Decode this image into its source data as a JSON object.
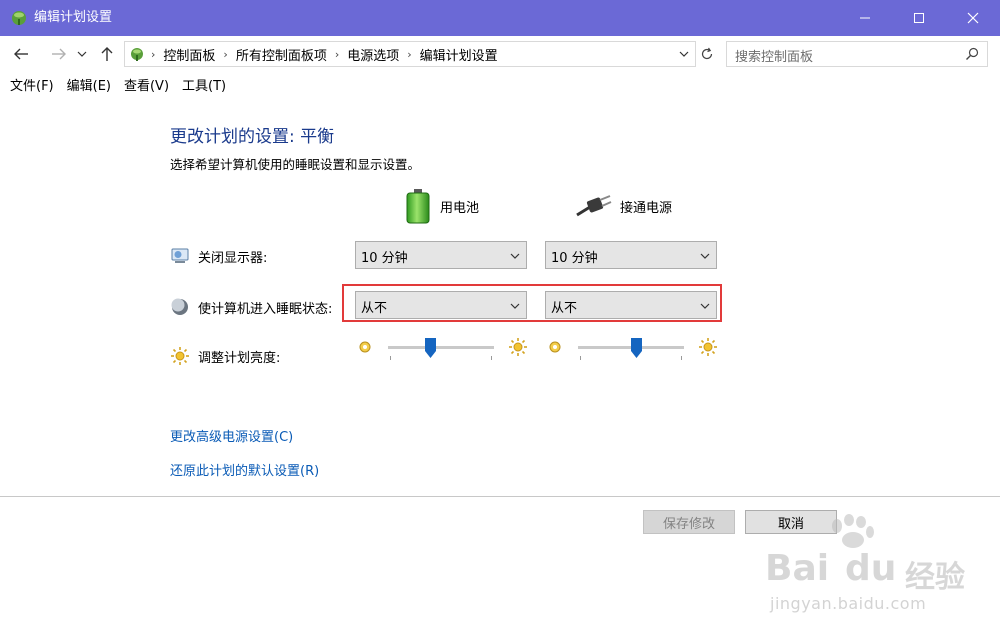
{
  "window": {
    "title": "编辑计划设置",
    "icon": "power-plan-icon"
  },
  "nav": {
    "breadcrumbs": [
      "控制面板",
      "所有控制面板项",
      "电源选项",
      "编辑计划设置"
    ],
    "search_placeholder": "搜索控制面板"
  },
  "menu": [
    "文件(F)",
    "编辑(E)",
    "查看(V)",
    "工具(T)"
  ],
  "main": {
    "heading": "更改计划的设置: 平衡",
    "subtitle": "选择希望计算机使用的睡眠设置和显示设置。",
    "columns": {
      "battery": "用电池",
      "plugged": "接通电源"
    },
    "rows": {
      "display": {
        "label": "关闭显示器:",
        "battery_value": "10 分钟",
        "plugged_value": "10 分钟"
      },
      "sleep": {
        "label": "使计算机进入睡眠状态:",
        "battery_value": "从不",
        "plugged_value": "从不"
      },
      "brightness": {
        "label": "调整计划亮度:",
        "battery_level": 0.4,
        "plugged_level": 0.55
      }
    },
    "links": {
      "advanced": "更改高级电源设置(C)",
      "restore": "还原此计划的默认设置(R)"
    },
    "buttons": {
      "save": "保存修改",
      "cancel": "取消"
    }
  },
  "watermark": {
    "brand": "Bai",
    "brand2": "du",
    "cn": "经验",
    "url": "jingyan.baidu.com"
  },
  "colors": {
    "titlebar": "#6b69d6",
    "heading": "#1a3a8c",
    "link": "#0a5bb6",
    "highlight": "#e23a3a",
    "slider_thumb": "#1565c0"
  }
}
